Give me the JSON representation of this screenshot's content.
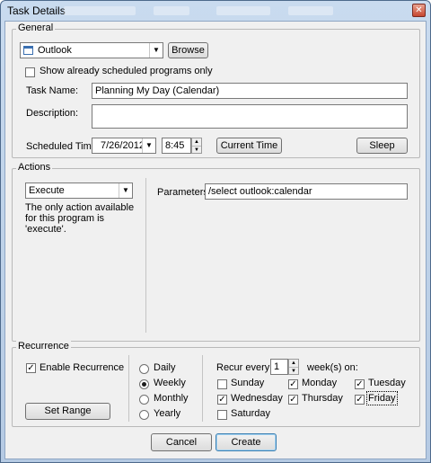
{
  "window": {
    "title": "Task Details",
    "close_glyph": "✕"
  },
  "general": {
    "legend": "General",
    "program_value": "Outlook",
    "browse_label": "Browse",
    "show_scheduled_label": "Show already scheduled programs only",
    "show_scheduled_checked": false,
    "task_name_label": "Task Name:",
    "task_name_value": "Planning My Day (Calendar)",
    "description_label": "Description:",
    "description_value": "",
    "scheduled_time_label": "Scheduled Time:",
    "date_value": "7/26/2012",
    "time_value": "8:45",
    "current_time_label": "Current Time",
    "sleep_label": "Sleep"
  },
  "actions": {
    "legend": "Actions",
    "action_value": "Execute",
    "note": "The only action available for this program is 'execute'.",
    "parameters_label": "Parameters:",
    "parameters_value": "/select outlook:calendar"
  },
  "recurrence": {
    "legend": "Recurrence",
    "enable_label": "Enable Recurrence",
    "enable_checked": true,
    "set_range_label": "Set Range",
    "frequency_options": [
      {
        "label": "Daily",
        "selected": false
      },
      {
        "label": "Weekly",
        "selected": true
      },
      {
        "label": "Monthly",
        "selected": false
      },
      {
        "label": "Yearly",
        "selected": false
      }
    ],
    "recur_every_label": "Recur every",
    "recur_every_value": "1",
    "weeks_on_label": "week(s) on:",
    "days": [
      {
        "label": "Sunday",
        "checked": false
      },
      {
        "label": "Monday",
        "checked": true
      },
      {
        "label": "Tuesday",
        "checked": true
      },
      {
        "label": "Wednesday",
        "checked": true
      },
      {
        "label": "Thursday",
        "checked": true
      },
      {
        "label": "Friday",
        "checked": true
      },
      {
        "label": "Saturday",
        "checked": false
      }
    ]
  },
  "footer": {
    "cancel_label": "Cancel",
    "create_label": "Create"
  },
  "icons": {
    "check_glyph": "✓",
    "arrow_down": "▼",
    "arrow_up": "▲",
    "program_icon": "window-icon"
  }
}
